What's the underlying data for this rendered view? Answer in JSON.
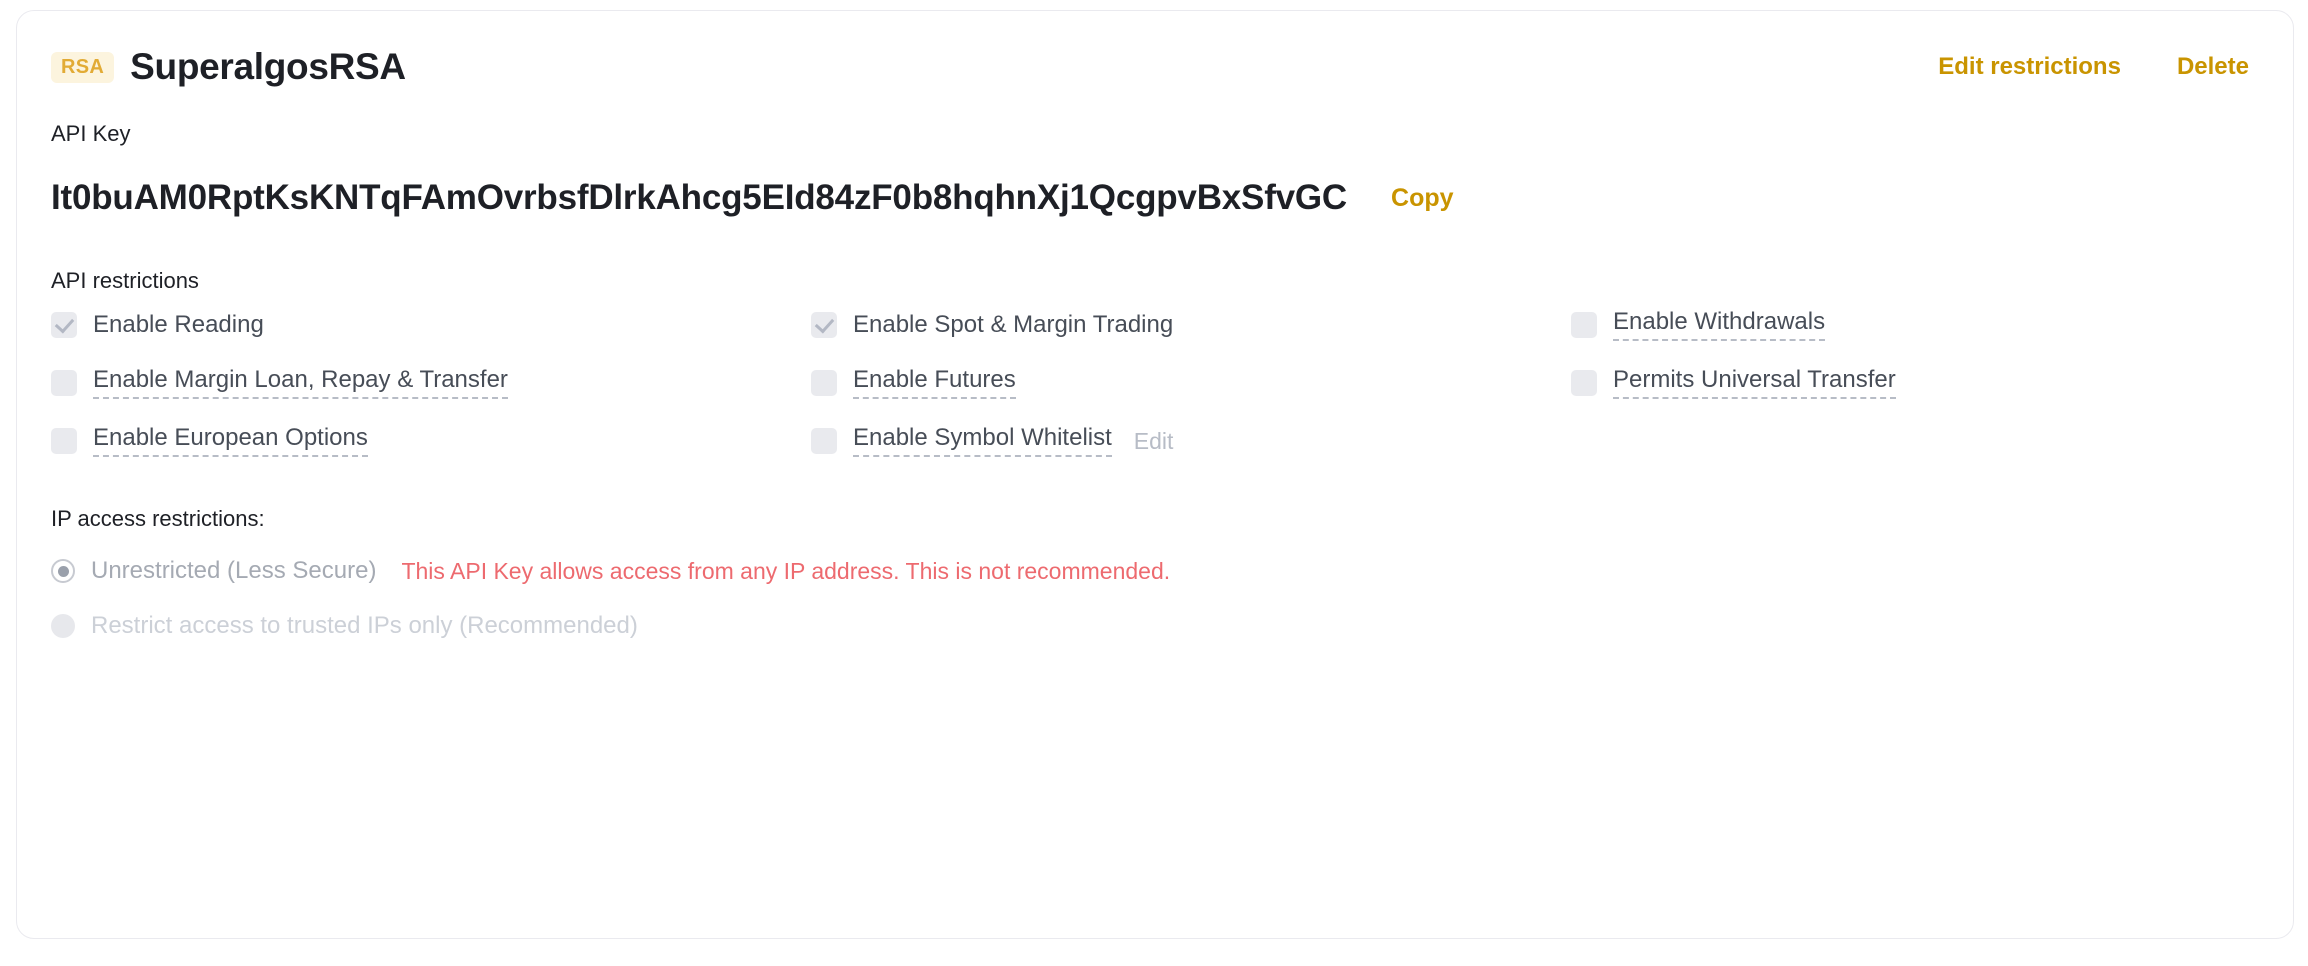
{
  "header": {
    "badge": "RSA",
    "key_name": "SuperalgosRSA",
    "edit_restrictions_label": "Edit restrictions",
    "delete_label": "Delete",
    "link_color": "#c99400",
    "badge_bg": "#fcf4de",
    "badge_color": "#e2ab35"
  },
  "api_key": {
    "label": "API Key",
    "value": "It0buAM0RptKsKNTqFAmOvrbsfDlrkAhcg5EId84zF0b8hqhnXj1QcgpvBxSfvGC",
    "copy_label": "Copy"
  },
  "restrictions": {
    "label": "API restrictions",
    "edit_whitelist_label": "Edit",
    "items": [
      {
        "label": "Enable Reading",
        "checked": true,
        "dashed": false
      },
      {
        "label": "Enable Spot & Margin Trading",
        "checked": true,
        "dashed": false
      },
      {
        "label": "Enable Withdrawals",
        "checked": false,
        "dashed": true
      },
      {
        "label": "Enable Margin Loan, Repay & Transfer",
        "checked": false,
        "dashed": true
      },
      {
        "label": "Enable Futures",
        "checked": false,
        "dashed": true
      },
      {
        "label": "Permits Universal Transfer",
        "checked": false,
        "dashed": true
      },
      {
        "label": "Enable European Options",
        "checked": false,
        "dashed": true
      },
      {
        "label": "Enable Symbol Whitelist",
        "checked": false,
        "dashed": true
      }
    ]
  },
  "ip_access": {
    "label": "IP access restrictions:",
    "options": [
      {
        "label": "Unrestricted (Less Secure)",
        "selected": true
      },
      {
        "label": "Restrict access to trusted IPs only (Recommended)",
        "selected": false
      }
    ],
    "warning": "This API Key allows access from any IP address. This is not recommended.",
    "warning_color": "#ed6a6f"
  }
}
